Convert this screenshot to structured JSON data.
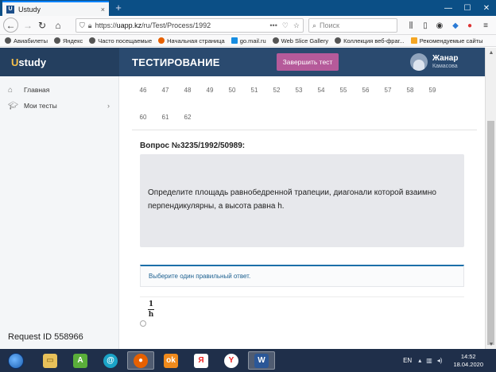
{
  "browser": {
    "tab_favicon": "U",
    "tab_title": "Ustudy",
    "tab_close": "×",
    "new_tab": "+",
    "url_prefix": "https://",
    "url_host": "uapp.kz",
    "url_path": "/ru/Test/Process/1992",
    "more": "•••",
    "search_placeholder": "Поиск",
    "window_controls": [
      "—",
      "☐",
      "✕"
    ]
  },
  "bookmarks": [
    {
      "label": "Авиабилеты",
      "color": "#555555"
    },
    {
      "label": "Яндекс",
      "color": "#555555"
    },
    {
      "label": "Часто посещаемые",
      "color": "#555555"
    },
    {
      "label": "Начальная страница",
      "color": "#e66000"
    },
    {
      "label": "go.mail.ru",
      "color": "#168de2"
    },
    {
      "label": "Web Slice Gallery",
      "color": "#555555"
    },
    {
      "label": "Коллекция веб-фраг...",
      "color": "#555555"
    },
    {
      "label": "Рекомендуемые сайты",
      "color": "#f5a623"
    }
  ],
  "app": {
    "brand_u": "U",
    "brand_rest": "study",
    "section_title": "ТЕСТИРОВАНИЕ",
    "finish_button": "Завершить тест",
    "user_name": "Жанар",
    "user_surname": "Камасова"
  },
  "sidebar": {
    "items": [
      {
        "label": "Главная",
        "icon": "home-icon"
      },
      {
        "label": "Мои тесты",
        "icon": "graduation-cap-icon"
      }
    ],
    "request_id": "Request ID 558966"
  },
  "question_numbers": [
    [
      "46",
      "47",
      "48",
      "49",
      "50",
      "51",
      "52",
      "53",
      "54",
      "55",
      "56",
      "57",
      "58",
      "59"
    ],
    [
      "60",
      "61",
      "62"
    ]
  ],
  "question": {
    "title": "Вопрос №3235/1992/50989:",
    "text": "Определите площадь равнобедренной трапеции, диагонали которой взаимно перпендикулярны, а высота равна h.",
    "hint": "Выберите один правильный ответ.",
    "answer_numerator": "1",
    "answer_denominator": "h"
  },
  "taskbar": {
    "lang": "EN",
    "time": "14:52",
    "date": "18.04.2020"
  },
  "colors": {
    "header": "#2a4a6f",
    "brand_bg": "#243f5f",
    "finish_button": "#b55a9a",
    "hint_accent": "#1b6fa8",
    "taskbar": "#1f2f4a"
  }
}
